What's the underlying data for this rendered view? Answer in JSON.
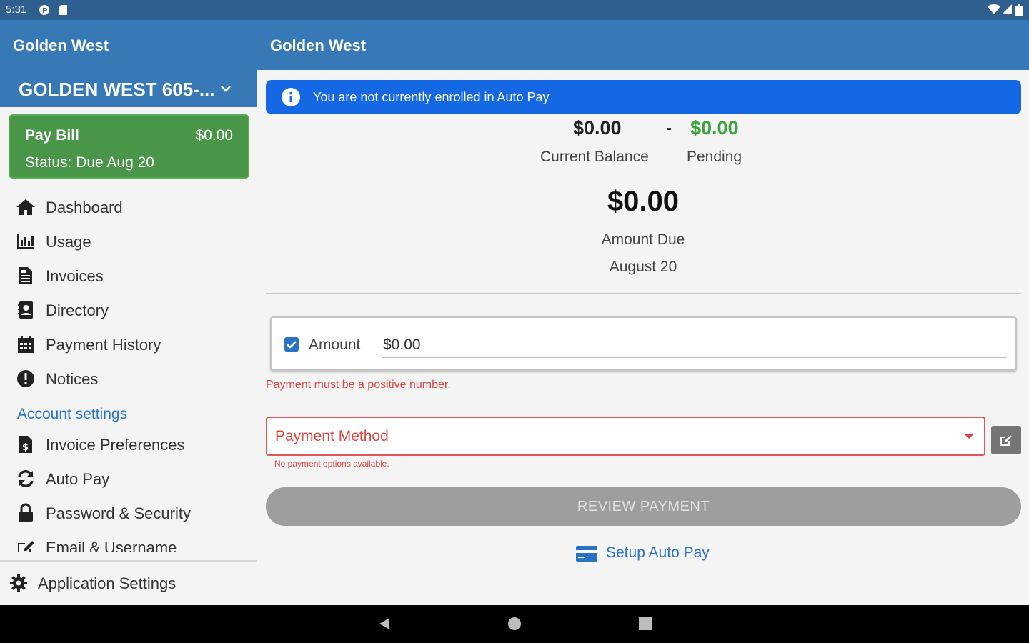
{
  "status_bar": {
    "time": "5:31"
  },
  "app_bar": {
    "left_title": "Golden West",
    "right_title": "Golden West"
  },
  "sidebar": {
    "account_name": "GOLDEN WEST 605-...",
    "pay_bill": {
      "title": "Pay Bill",
      "amount": "$0.00",
      "status": "Status: Due Aug 20"
    },
    "items": [
      {
        "label": "Dashboard",
        "icon": "home-icon"
      },
      {
        "label": "Usage",
        "icon": "bar-chart-icon"
      },
      {
        "label": "Invoices",
        "icon": "invoice-icon"
      },
      {
        "label": "Directory",
        "icon": "contact-book-icon"
      },
      {
        "label": "Payment History",
        "icon": "calendar-icon"
      },
      {
        "label": "Notices",
        "icon": "exclamation-circle-icon"
      }
    ],
    "section_header": "Account settings",
    "settings_items": [
      {
        "label": "Invoice Preferences",
        "icon": "file-dollar-icon"
      },
      {
        "label": "Auto Pay",
        "icon": "sync-icon"
      },
      {
        "label": "Password & Security",
        "icon": "lock-icon"
      },
      {
        "label": "Email & Username",
        "icon": "edit-icon"
      }
    ],
    "app_settings": "Application Settings"
  },
  "main": {
    "banner": "You are not currently enrolled in Auto Pay",
    "current_balance": {
      "amount": "$0.00",
      "label": "Current Balance"
    },
    "separator": "-",
    "pending": {
      "amount": "$0.00",
      "label": "Pending"
    },
    "amount_due": {
      "amount": "$0.00",
      "label": "Amount Due",
      "date": "August 20"
    },
    "amount_field": {
      "label": "Amount",
      "value": "$0.00",
      "checked": true
    },
    "amount_error": "Payment must be a positive number.",
    "payment_method": {
      "label": "Payment Method",
      "hint": "No payment options available."
    },
    "review_button": "REVIEW PAYMENT",
    "setup_autopay": "Setup Auto Pay"
  },
  "colors": {
    "app_bar": "#3679b6",
    "status_bar": "#2f5f8e",
    "pay_bill_green": "#4a9648",
    "banner_blue": "#1468e3",
    "pending_green": "#3ca33a",
    "error_red": "#e0443f",
    "link_blue": "#2a72c2"
  }
}
